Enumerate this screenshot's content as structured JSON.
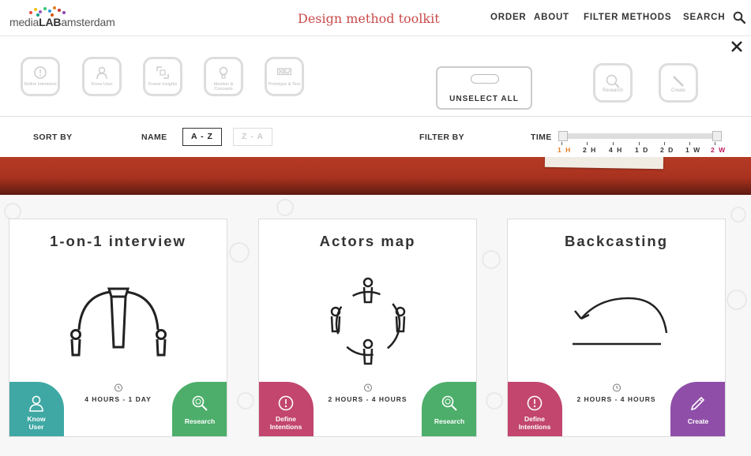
{
  "header": {
    "logo_text_pre": "media",
    "logo_text_bold": "LAB",
    "logo_text_post": "amsterdam",
    "site_title": "Design method toolkit",
    "nav": {
      "order": "ORDER",
      "about": "ABOUT",
      "filter_methods": "FILTER METHODS",
      "search": "SEARCH"
    }
  },
  "filter_panel": {
    "phase_categories": [
      {
        "label": "Define Intentions",
        "icon": "compass-icon"
      },
      {
        "label": "Know User",
        "icon": "user-icon"
      },
      {
        "label": "Frame Insights",
        "icon": "frame-icon"
      },
      {
        "label": "Ideation & Concepts",
        "icon": "bulb-icon"
      },
      {
        "label": "Prototype & Test",
        "icon": "prototype-icon"
      }
    ],
    "unselect_all": "UNSELECT ALL",
    "mode_categories": [
      {
        "label": "Research",
        "icon": "magnifier-icon"
      },
      {
        "label": "Create",
        "icon": "pencil-icon"
      }
    ]
  },
  "sort_row": {
    "sort_by": "SORT BY",
    "name": "NAME",
    "a_z": "A - Z",
    "z_a": "Z - A",
    "filter_by": "FILTER BY",
    "time": "TIME",
    "time_ticks": [
      "1 H",
      "2 H",
      "4 H",
      "1 D",
      "2 D",
      "1 W",
      "2 W"
    ],
    "time_selected_range": [
      "1 H",
      "2 W"
    ]
  },
  "colors": {
    "title_red": "#c94b4b",
    "know_user_teal": "#3fa8a4",
    "research_green": "#4cae6a",
    "define_intentions_pink": "#c2466e",
    "create_purple": "#8f4fa8",
    "tick_min_orange": "#e67e22",
    "tick_max_magenta": "#c2185b"
  },
  "cards": [
    {
      "title": "1-on-1 interview",
      "illustration": "interview-icon",
      "time": "4 HOURS - 1 DAY",
      "badge_left": {
        "label_line1": "Know",
        "label_line2": "User",
        "icon": "user-icon"
      },
      "badge_right": {
        "label": "Research",
        "icon": "magnifier-icon"
      }
    },
    {
      "title": "Actors map",
      "illustration": "actors-map-icon",
      "time": "2 HOURS - 4 HOURS",
      "badge_left": {
        "label_line1": "Define",
        "label_line2": "Intentions",
        "icon": "compass-icon"
      },
      "badge_right": {
        "label": "Research",
        "icon": "magnifier-icon"
      }
    },
    {
      "title": "Backcasting",
      "illustration": "backcasting-icon",
      "time": "2 HOURS - 4 HOURS",
      "badge_left": {
        "label_line1": "Define",
        "label_line2": "Intentions",
        "icon": "compass-icon"
      },
      "badge_right": {
        "label": "Create",
        "icon": "pencil-icon"
      }
    }
  ]
}
